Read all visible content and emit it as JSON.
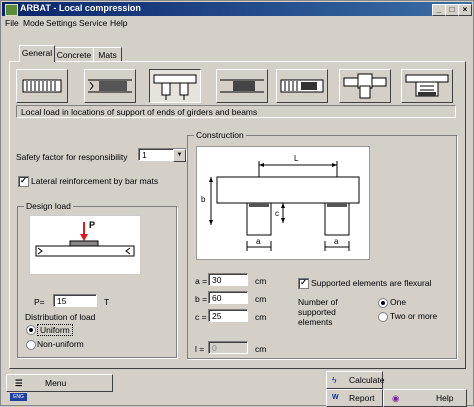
{
  "window": {
    "title": "ARBAT - Local compression",
    "icon": "app-icon"
  },
  "menu": [
    "File",
    "Mode",
    "Settings",
    "Service",
    "Help"
  ],
  "tabs": [
    "General",
    "Concrete",
    "Mats"
  ],
  "toolbar_icons": [
    "support-type-1-icon",
    "support-type-2-icon",
    "support-type-3-icon",
    "support-type-4-icon",
    "support-type-5-icon",
    "support-type-6-icon",
    "support-type-7-icon"
  ],
  "description": "Local load in locations of support of ends of girders and beams",
  "safety": {
    "label": "Safety factor for responsibility",
    "value": "1"
  },
  "lateral": {
    "label": "Lateral reinforcement by bar mats",
    "checked": true
  },
  "design_load": {
    "title": "Design load",
    "p_marker": "P",
    "p_label": "P=",
    "p_value": "15",
    "p_unit": "T",
    "distribution_label": "Distribution of load",
    "options": [
      "Uniform",
      "Non-uniform"
    ],
    "selected": "Uniform"
  },
  "construction": {
    "title": "Construction",
    "dims": {
      "L": "L",
      "b": "b",
      "c": "c",
      "a1": "a",
      "a2": "a"
    },
    "inputs": [
      {
        "label": "a =",
        "value": "30",
        "unit": "cm"
      },
      {
        "label": "b =",
        "value": "60",
        "unit": "cm"
      },
      {
        "label": "c =",
        "value": "25",
        "unit": "cm"
      },
      {
        "label": "l =",
        "value": "0",
        "unit": "cm"
      }
    ],
    "supported_flexural": {
      "label": "Supported elements are flexural",
      "checked": true
    },
    "number_label": "Number of supported elements",
    "number_options": [
      "One",
      "Two or more"
    ],
    "number_selected": "One"
  },
  "bottom": {
    "menu_label": "Menu",
    "calculate_label": "Calculate",
    "report_label": "Report",
    "help_label": "Help",
    "lang_badge": "ENG"
  },
  "colors": {
    "accent_red": "#e01818",
    "title_blue": "#0a246a",
    "face": "#d4d0c8"
  }
}
